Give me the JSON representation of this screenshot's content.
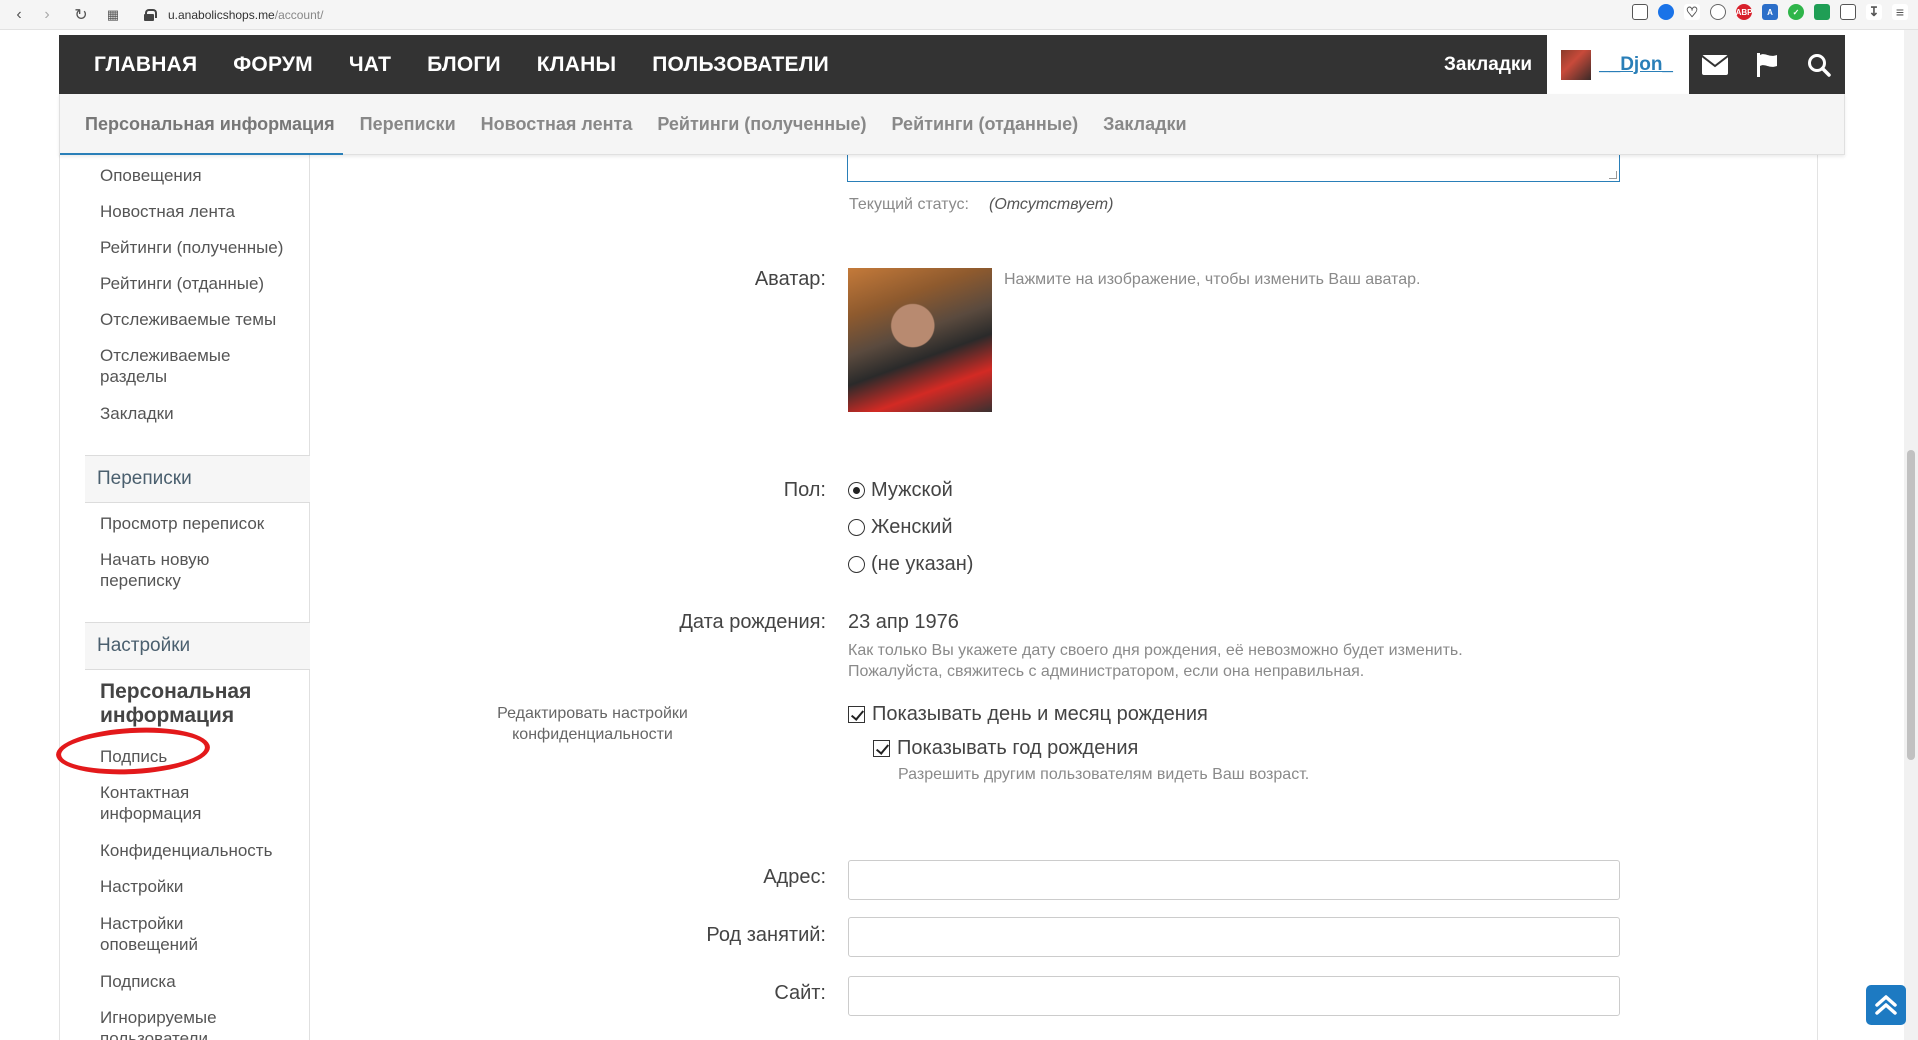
{
  "browser": {
    "url_host": "u.anabolicshops.me",
    "url_path": "/account/"
  },
  "main_nav": {
    "items": [
      "ГЛАВНАЯ",
      "ФОРУМ",
      "ЧАТ",
      "БЛОГИ",
      "КЛАНЫ",
      "ПОЛЬЗОВАТЕЛИ"
    ],
    "bookmarks": "Закладки",
    "username": "__Djon_"
  },
  "sub_nav": {
    "items": [
      "Персональная информация",
      "Переписки",
      "Новостная лента",
      "Рейтинги (полученные)",
      "Рейтинги (отданные)",
      "Закладки"
    ]
  },
  "sidebar": {
    "links_top": [
      "Оповещения",
      "Новостная лента",
      "Рейтинги (полученные)",
      "Рейтинги (отданные)",
      "Отслеживаемые темы",
      "Отслеживаемые разделы",
      "Закладки"
    ],
    "section_conversations": "Переписки",
    "conversation_links": [
      "Просмотр переписок",
      "Начать новую переписку"
    ],
    "section_settings": "Настройки",
    "active_item": "Персональная информация",
    "settings_links": [
      "Подпись",
      "Контактная информация",
      "Конфиденциальность",
      "Настройки",
      "Настройки оповещений",
      "Подписка",
      "Игнорируемые пользователи"
    ]
  },
  "form": {
    "status_label": "Текущий статус:",
    "status_value": "(Отсутствует)",
    "avatar_label": "Аватар:",
    "avatar_hint": "Нажмите на изображение, чтобы изменить Ваш аватар.",
    "gender_label": "Пол:",
    "gender_options": [
      "Мужской",
      "Женский",
      "(не указан)"
    ],
    "gender_selected": "Мужской",
    "dob_label": "Дата рождения:",
    "dob_value": "23 апр 1976",
    "dob_hint_1": "Как только Вы укажете дату своего дня рождения, её невозможно будет изменить.",
    "dob_hint_2": "Пожалуйста, свяжитесь с администратором, если она неправильная.",
    "privacy_link_1": "Редактировать настройки",
    "privacy_link_2": "конфиденциальности",
    "show_day_month": "Показывать день и месяц рождения",
    "show_day_month_checked": true,
    "show_year": "Показывать год рождения",
    "show_year_checked": true,
    "age_hint": "Разрешить другим пользователям видеть Ваш возраст.",
    "address_label": "Адрес:",
    "address_value": "",
    "occupation_label": "Род занятий:",
    "occupation_value": "",
    "website_label": "Сайт:",
    "website_value": ""
  },
  "colors": {
    "nav_bg": "#333333",
    "accent": "#2a7fb8",
    "annotation": "#e3191b"
  }
}
